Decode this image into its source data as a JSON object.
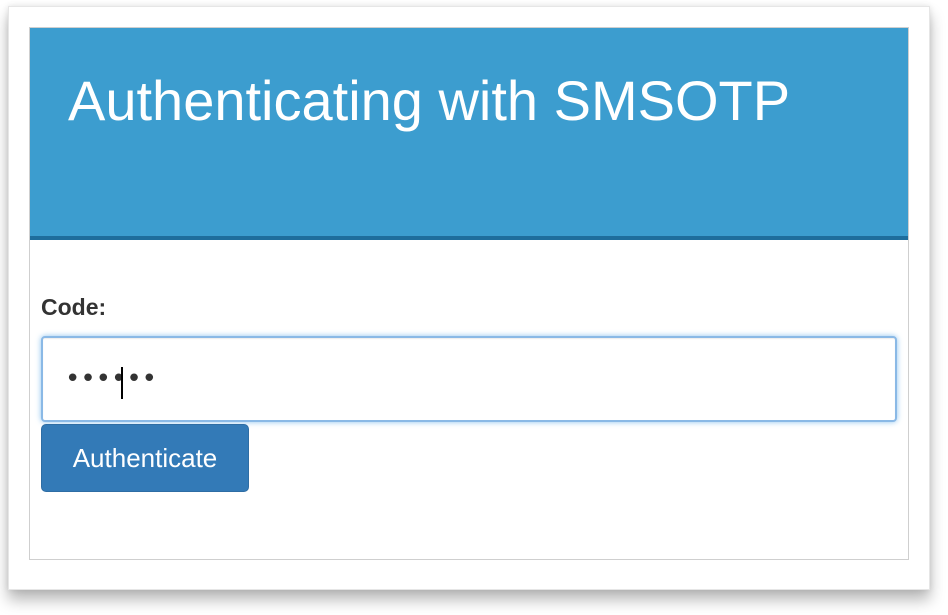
{
  "header": {
    "title": "Authenticating with SMSOTP"
  },
  "form": {
    "code_label": "Code:",
    "code_value": "••••••",
    "submit_label": "Authenticate"
  },
  "colors": {
    "header_bg": "#3c9dcf",
    "header_border": "#1e6d9c",
    "button_bg": "#337ab7",
    "input_focus": "#66afe9"
  }
}
